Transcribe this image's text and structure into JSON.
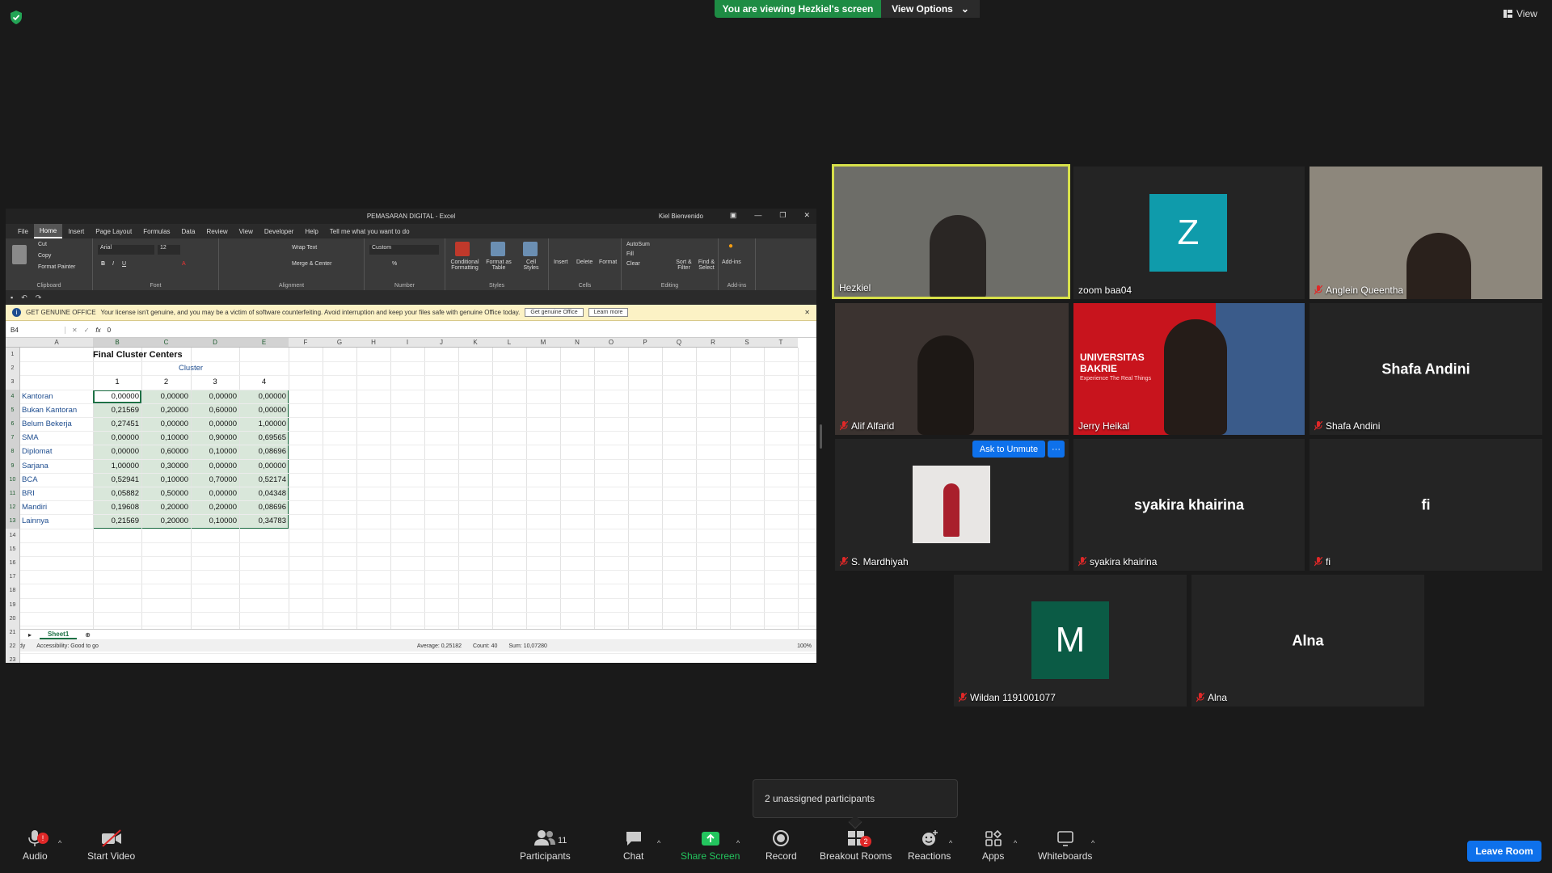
{
  "zoom": {
    "banner_text": "You are viewing Hezkiel's screen",
    "view_options_label": "View Options",
    "view_label": "View",
    "leave_label": "Leave Room",
    "toast_text": "2 unassigned participants",
    "ask_unmute_label": "Ask to Unmute",
    "more_label": "···",
    "toolbar": {
      "audio": "Audio",
      "audio_badge": "!",
      "start_video": "Start Video",
      "participants": "Participants",
      "participants_count": "11",
      "chat": "Chat",
      "share_screen": "Share Screen",
      "record": "Record",
      "breakout": "Breakout Rooms",
      "breakout_badge": "2",
      "reactions": "Reactions",
      "apps": "Apps",
      "whiteboards": "Whiteboards"
    },
    "tiles": [
      {
        "name": "Hezkiel",
        "muted": false
      },
      {
        "name": "zoom baa04",
        "muted": false,
        "initial": "Z"
      },
      {
        "name": "Anglein Queentha",
        "muted": true
      },
      {
        "name": "Alif Alfarid",
        "muted": true
      },
      {
        "name": "Jerry Heikal",
        "muted": false
      },
      {
        "name": "Shafa Andini",
        "muted": true
      },
      {
        "name": "S. Mardhiyah",
        "muted": true
      },
      {
        "name": "syakira khairina",
        "muted": true
      },
      {
        "name": "fi",
        "muted": true
      },
      {
        "name": "Wildan 1191001077",
        "muted": true,
        "initial": "M"
      },
      {
        "name": "Alna",
        "muted": true
      }
    ],
    "jerry_bg_text": "UNIVERSITAS BAKRIE",
    "jerry_bg_sub": "Experience The Real Things"
  },
  "excel": {
    "title": "PEMASARAN DIGITAL  -  Excel",
    "user": "Kiel Bienvenido",
    "tabs": [
      "File",
      "Home",
      "Insert",
      "Page Layout",
      "Formulas",
      "Data",
      "Review",
      "View",
      "Developer",
      "Help",
      "Tell me what you want to do"
    ],
    "ribbon": {
      "clipboard": {
        "cut": "Cut",
        "copy": "Copy",
        "format_painter": "Format Painter",
        "name": "Clipboard"
      },
      "font": {
        "family": "Arial",
        "size": "12",
        "name": "Font"
      },
      "alignment": {
        "wrap": "Wrap Text",
        "merge": "Merge & Center",
        "name": "Alignment"
      },
      "number": {
        "format": "Custom",
        "name": "Number"
      },
      "styles": {
        "cond": "Conditional Formatting",
        "table": "Format as Table",
        "cell": "Cell Styles",
        "name": "Styles"
      },
      "cells": {
        "insert": "Insert",
        "delete": "Delete",
        "format": "Format",
        "name": "Cells"
      },
      "editing": {
        "autosum": "AutoSum",
        "fill": "Fill",
        "clear": "Clear",
        "sort": "Sort & Filter",
        "find": "Find & Select",
        "name": "Editing"
      },
      "addins": {
        "label": "Add-ins",
        "name": "Add-ins"
      }
    },
    "warning": {
      "title": "GET GENUINE OFFICE",
      "text": "Your license isn't genuine, and you may be a victim of software counterfeiting. Avoid interruption and keep your files safe with genuine Office today.",
      "btn1": "Get genuine Office",
      "btn2": "Learn more"
    },
    "name_box": "B4",
    "formula_value": "0",
    "columns": [
      "A",
      "B",
      "C",
      "D",
      "E",
      "F",
      "G",
      "H",
      "I",
      "J",
      "K",
      "L",
      "M",
      "N",
      "O",
      "P",
      "Q",
      "R",
      "S",
      "T"
    ],
    "rows": [
      "1",
      "2",
      "3",
      "4",
      "5",
      "6",
      "7",
      "8",
      "9",
      "10",
      "11",
      "12",
      "13",
      "14",
      "15",
      "16",
      "17",
      "18",
      "19",
      "20",
      "21",
      "22",
      "23"
    ],
    "table_title": "Final Cluster Centers",
    "cluster_label": "Cluster",
    "cluster_nums": [
      "1",
      "2",
      "3",
      "4"
    ],
    "data_rows": [
      {
        "label": "Kantoran",
        "v": [
          "0,00000",
          "0,00000",
          "0,00000",
          "0,00000"
        ]
      },
      {
        "label": "Bukan Kantoran",
        "v": [
          "0,21569",
          "0,20000",
          "0,60000",
          "0,00000"
        ]
      },
      {
        "label": "Belum Bekerja",
        "v": [
          "0,27451",
          "0,00000",
          "0,00000",
          "1,00000"
        ]
      },
      {
        "label": "SMA",
        "v": [
          "0,00000",
          "0,10000",
          "0,90000",
          "0,69565"
        ]
      },
      {
        "label": "Diplomat",
        "v": [
          "0,00000",
          "0,60000",
          "0,10000",
          "0,08696"
        ]
      },
      {
        "label": "Sarjana",
        "v": [
          "1,00000",
          "0,30000",
          "0,00000",
          "0,00000"
        ]
      },
      {
        "label": "BCA",
        "v": [
          "0,52941",
          "0,10000",
          "0,70000",
          "0,52174"
        ]
      },
      {
        "label": "BRI",
        "v": [
          "0,05882",
          "0,50000",
          "0,00000",
          "0,04348"
        ]
      },
      {
        "label": "Mandiri",
        "v": [
          "0,19608",
          "0,20000",
          "0,20000",
          "0,08696"
        ]
      },
      {
        "label": "Lainnya",
        "v": [
          "0,21569",
          "0,20000",
          "0,10000",
          "0,34783"
        ]
      }
    ],
    "sheet_tab": "Sheet1",
    "status": {
      "ready": "Ready",
      "accessibility": "Accessibility: Good to go",
      "average": "Average: 0,25182",
      "count": "Count: 40",
      "sum": "Sum: 10,07280",
      "zoom": "100%"
    }
  },
  "colors": {
    "zoom_blue": "#0e71eb",
    "banner_green": "#1e8c44",
    "excel_green": "#1e7145",
    "z_avatar": "#0f9bab",
    "m_avatar": "#0b5b45",
    "active_speaker": "#d7e04a"
  }
}
